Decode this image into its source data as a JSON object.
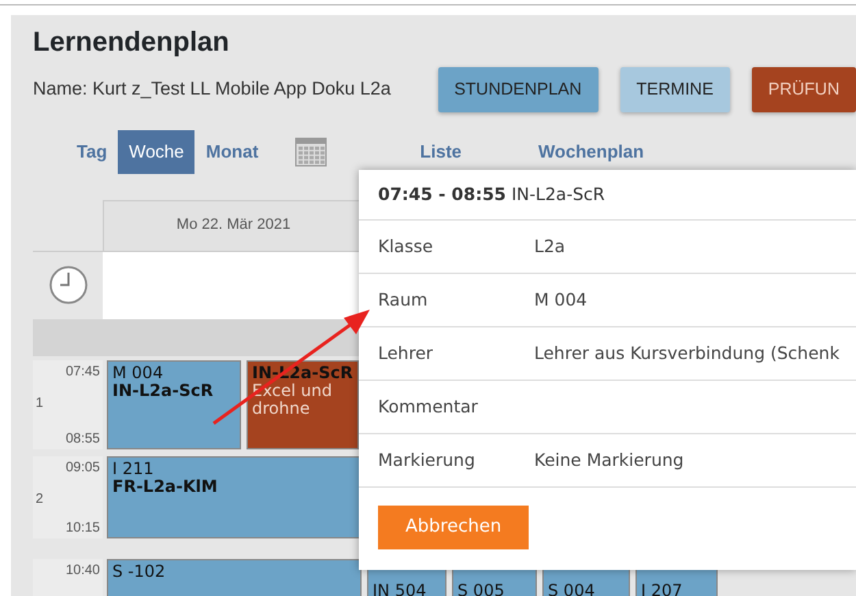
{
  "title": "Lernendenplan",
  "name_line": "Name: Kurt z_Test LL Mobile App Doku L2a",
  "view_buttons": [
    {
      "label": "STUNDENPLAN",
      "color": "#6ca3c7"
    },
    {
      "label": "TERMINE",
      "color": "#a7c8de"
    },
    {
      "label": "PRÜFUN",
      "color": "#a5431f"
    }
  ],
  "nav_left": [
    {
      "label": "Tag",
      "selected": false
    },
    {
      "label": "Woche",
      "selected": true
    },
    {
      "label": "Monat",
      "selected": false
    }
  ],
  "nav_right": [
    {
      "label": "Liste",
      "selected": false
    },
    {
      "label": "Wochenplan",
      "selected": false
    }
  ],
  "calendar": {
    "day_header": "Mo 22. Mär 2021",
    "periods": [
      {
        "number": "1",
        "start": "07:45",
        "end": "08:55",
        "events": [
          {
            "room": "M 004",
            "course": "IN-L2a-ScR",
            "color": "#6ca3c7"
          },
          {
            "course": "IN-L2a-ScR",
            "note": "Excel und drohne",
            "color": "#a5431f"
          }
        ]
      },
      {
        "number": "2",
        "start": "09:05",
        "end": "10:15",
        "events": [
          {
            "room": "I 211",
            "course": "FR-L2a-KlM",
            "color": "#6ca3c7"
          }
        ]
      },
      {
        "start": "10:40",
        "events": [
          {
            "room": "S -102",
            "color": "#6ca3c7"
          },
          {
            "room": "IN 504",
            "color": "#6ca3c7"
          },
          {
            "room": "S 005",
            "color": "#6ca3c7"
          },
          {
            "room": "S 004",
            "color": "#6ca3c7"
          },
          {
            "room": "I 207",
            "color": "#6ca3c7"
          }
        ]
      }
    ]
  },
  "popup": {
    "heading": "**07:45 - 08:55** IN-L2a-ScR",
    "rows": [
      {
        "label": "Klasse",
        "value": "L2a"
      },
      {
        "label": "Raum",
        "value": "M 004"
      },
      {
        "label": "Lehrer",
        "value": "Lehrer aus Kursverbindung (Schenk"
      },
      {
        "label": "Kommentar"
      },
      {
        "label": "Markierung",
        "value": "Keine Markierung"
      }
    ],
    "button": "Abbrechen"
  }
}
